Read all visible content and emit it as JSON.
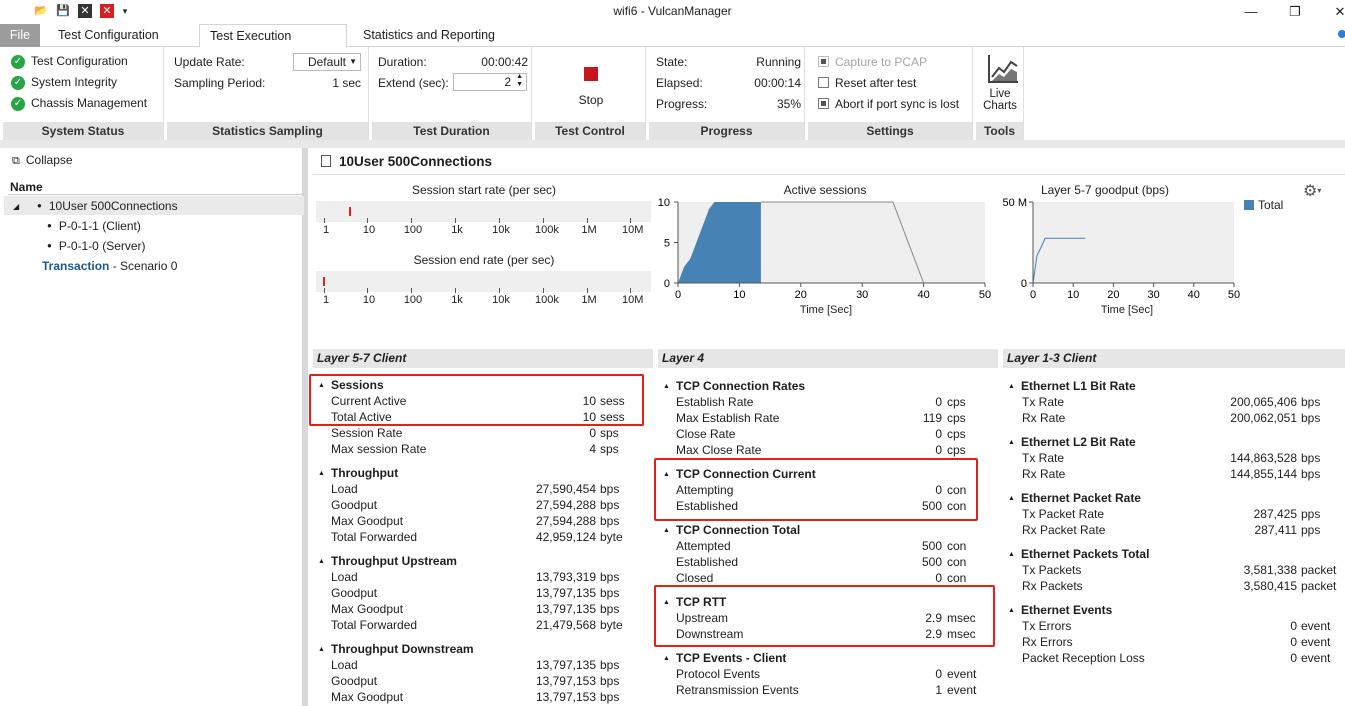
{
  "window": {
    "title": "wifi6 - VulcanManager"
  },
  "tabs": [
    "File",
    "Test Configuration",
    "Test Execution",
    "Statistics and Reporting"
  ],
  "ribbon": {
    "system_status": {
      "label": "System Status",
      "items": [
        "Test Configuration",
        "System Integrity",
        "Chassis Management"
      ]
    },
    "statistics_sampling": {
      "label": "Statistics Sampling",
      "update_rate_label": "Update Rate:",
      "update_rate_value": "Default",
      "sampling_period_label": "Sampling Period:",
      "sampling_period_value": "1 sec"
    },
    "test_duration": {
      "label": "Test Duration",
      "duration_label": "Duration:",
      "duration_value": "00:00:42",
      "extend_label": "Extend (sec):",
      "extend_value": "2"
    },
    "test_control": {
      "label": "Test Control",
      "stop_label": "Stop"
    },
    "progress": {
      "label": "Progress",
      "state_label": "State:",
      "state_value": "Running",
      "elapsed_label": "Elapsed:",
      "elapsed_value": "00:00:14",
      "progress_label": "Progress:",
      "progress_value": "35%",
      "progress_fraction": 0.35
    },
    "settings": {
      "label": "Settings",
      "capture": "Capture to PCAP",
      "reset": "Reset after test",
      "abort": "Abort if port sync is lost"
    },
    "tools": {
      "label": "Tools",
      "live_charts_1": "Live",
      "live_charts_2": "Charts"
    }
  },
  "tree": {
    "collapse_label": "Collapse",
    "name_header": "Name",
    "root": "10User 500Connections",
    "child1": "P-0-1-1 (Client)",
    "child2": "P-0-1-0 (Server)",
    "transaction_link": "Transaction",
    "transaction_suffix": " - Scenario 0"
  },
  "main": {
    "title": "10User 500Connections"
  },
  "charts": {
    "start_title": "Session start rate (per sec)",
    "end_title": "Session end rate (per sec)",
    "log_ticks": [
      "1",
      "10",
      "100",
      "1k",
      "10k",
      "100k",
      "1M",
      "10M"
    ],
    "active_title": "Active sessions",
    "goodput_title": "Layer 5-7 goodput (bps)",
    "time_label": "Time [Sec]",
    "legend_total": "Total",
    "colors": {
      "series": "#4682b4",
      "marker": "#e5201b"
    }
  },
  "chart_data": [
    {
      "type": "line",
      "title": "Session start rate (per sec)",
      "xscale": "log",
      "xticks": [
        "1",
        "10",
        "100",
        "1k",
        "10k",
        "100k",
        "1M",
        "10M"
      ],
      "marker_at": 4
    },
    {
      "type": "line",
      "title": "Session end rate (per sec)",
      "xscale": "log",
      "xticks": [
        "1",
        "10",
        "100",
        "1k",
        "10k",
        "100k",
        "1M",
        "10M"
      ],
      "marker_at": 1
    },
    {
      "type": "area",
      "title": "Active sessions",
      "xlabel": "Time [Sec]",
      "xlim": [
        0,
        50
      ],
      "ylim": [
        0,
        10
      ],
      "xticks": [
        0,
        10,
        20,
        30,
        40,
        50
      ],
      "yticks": [
        0,
        5,
        10
      ],
      "x": [
        0,
        1,
        2,
        3,
        4,
        5,
        6,
        13.5
      ],
      "y": [
        0,
        2,
        3,
        5,
        7,
        9,
        10,
        10
      ],
      "projection_x": [
        13.5,
        35,
        40
      ],
      "projection_y": [
        10,
        10,
        0
      ]
    },
    {
      "type": "line",
      "title": "Layer 5-7 goodput (bps)",
      "xlabel": "Time [Sec]",
      "xlim": [
        0,
        50
      ],
      "yticks": [
        "0",
        "50 M"
      ],
      "xticks": [
        0,
        10,
        20,
        30,
        40,
        50
      ],
      "series": [
        {
          "name": "Total",
          "x": [
            0,
            1,
            2,
            3,
            4,
            13
          ],
          "y": [
            0,
            17,
            22,
            27.6,
            27.6,
            27.6
          ]
        }
      ]
    }
  ],
  "panels": {
    "l57": {
      "header": "Layer 5-7 Client"
    },
    "l4": {
      "header": "Layer 4"
    },
    "l13": {
      "header": "Layer 1-3 Client"
    }
  },
  "l57_sections": [
    {
      "title": "Sessions",
      "rows": [
        [
          "Current Active",
          "10",
          "sess"
        ],
        [
          "Total Active",
          "10",
          "sess"
        ],
        [
          "Session Rate",
          "0",
          "sps"
        ],
        [
          "Max session Rate",
          "4",
          "sps"
        ]
      ]
    },
    {
      "title": "Throughput",
      "rows": [
        [
          "Load",
          "27,590,454",
          "bps"
        ],
        [
          "Goodput",
          "27,594,288",
          "bps"
        ],
        [
          "Max Goodput",
          "27,594,288",
          "bps"
        ],
        [
          "Total Forwarded",
          "42,959,124",
          "byte"
        ]
      ]
    },
    {
      "title": "Throughput Upstream",
      "rows": [
        [
          "Load",
          "13,793,319",
          "bps"
        ],
        [
          "Goodput",
          "13,797,135",
          "bps"
        ],
        [
          "Max Goodput",
          "13,797,135",
          "bps"
        ],
        [
          "Total Forwarded",
          "21,479,568",
          "byte"
        ]
      ]
    },
    {
      "title": "Throughput Downstream",
      "rows": [
        [
          "Load",
          "13,797,135",
          "bps"
        ],
        [
          "Goodput",
          "13,797,153",
          "bps"
        ],
        [
          "Max Goodput",
          "13,797,153",
          "bps"
        ]
      ]
    }
  ],
  "l4_sections": [
    {
      "title": "TCP Connection Rates",
      "rows": [
        [
          "Establish Rate",
          "0",
          "cps"
        ],
        [
          "Max Establish Rate",
          "119",
          "cps"
        ],
        [
          "Close Rate",
          "0",
          "cps"
        ],
        [
          "Max Close Rate",
          "0",
          "cps"
        ]
      ]
    },
    {
      "title": "TCP Connection Current",
      "rows": [
        [
          "Attempting",
          "0",
          "con"
        ],
        [
          "Established",
          "500",
          "con"
        ]
      ]
    },
    {
      "title": "TCP Connection Total",
      "rows": [
        [
          "Attempted",
          "500",
          "con"
        ],
        [
          "Established",
          "500",
          "con"
        ],
        [
          "Closed",
          "0",
          "con"
        ]
      ]
    },
    {
      "title": "TCP RTT",
      "rows": [
        [
          "Upstream",
          "2.9",
          "msec"
        ],
        [
          "Downstream",
          "2.9",
          "msec"
        ]
      ]
    },
    {
      "title": "TCP Events - Client",
      "rows": [
        [
          "Protocol Events",
          "0",
          "event"
        ],
        [
          "Retransmission Events",
          "1",
          "event"
        ]
      ]
    }
  ],
  "l13_sections": [
    {
      "title": "Ethernet L1 Bit Rate",
      "rows": [
        [
          "Tx Rate",
          "200,065,406",
          "bps"
        ],
        [
          "Rx Rate",
          "200,062,051",
          "bps"
        ]
      ]
    },
    {
      "title": "Ethernet L2 Bit Rate",
      "rows": [
        [
          "Tx Rate",
          "144,863,528",
          "bps"
        ],
        [
          "Rx Rate",
          "144,855,144",
          "bps"
        ]
      ]
    },
    {
      "title": "Ethernet Packet Rate",
      "rows": [
        [
          "Tx Packet Rate",
          "287,425",
          "pps"
        ],
        [
          "Rx Packet Rate",
          "287,411",
          "pps"
        ]
      ]
    },
    {
      "title": "Ethernet Packets Total",
      "rows": [
        [
          "Tx Packets",
          "3,581,338",
          "packet"
        ],
        [
          "Rx Packets",
          "3,580,415",
          "packet"
        ]
      ]
    },
    {
      "title": "Ethernet Events",
      "rows": [
        [
          "Tx Errors",
          "0",
          "event"
        ],
        [
          "Rx Errors",
          "0",
          "event"
        ],
        [
          "Packet Reception Loss",
          "0",
          "event"
        ]
      ]
    }
  ]
}
